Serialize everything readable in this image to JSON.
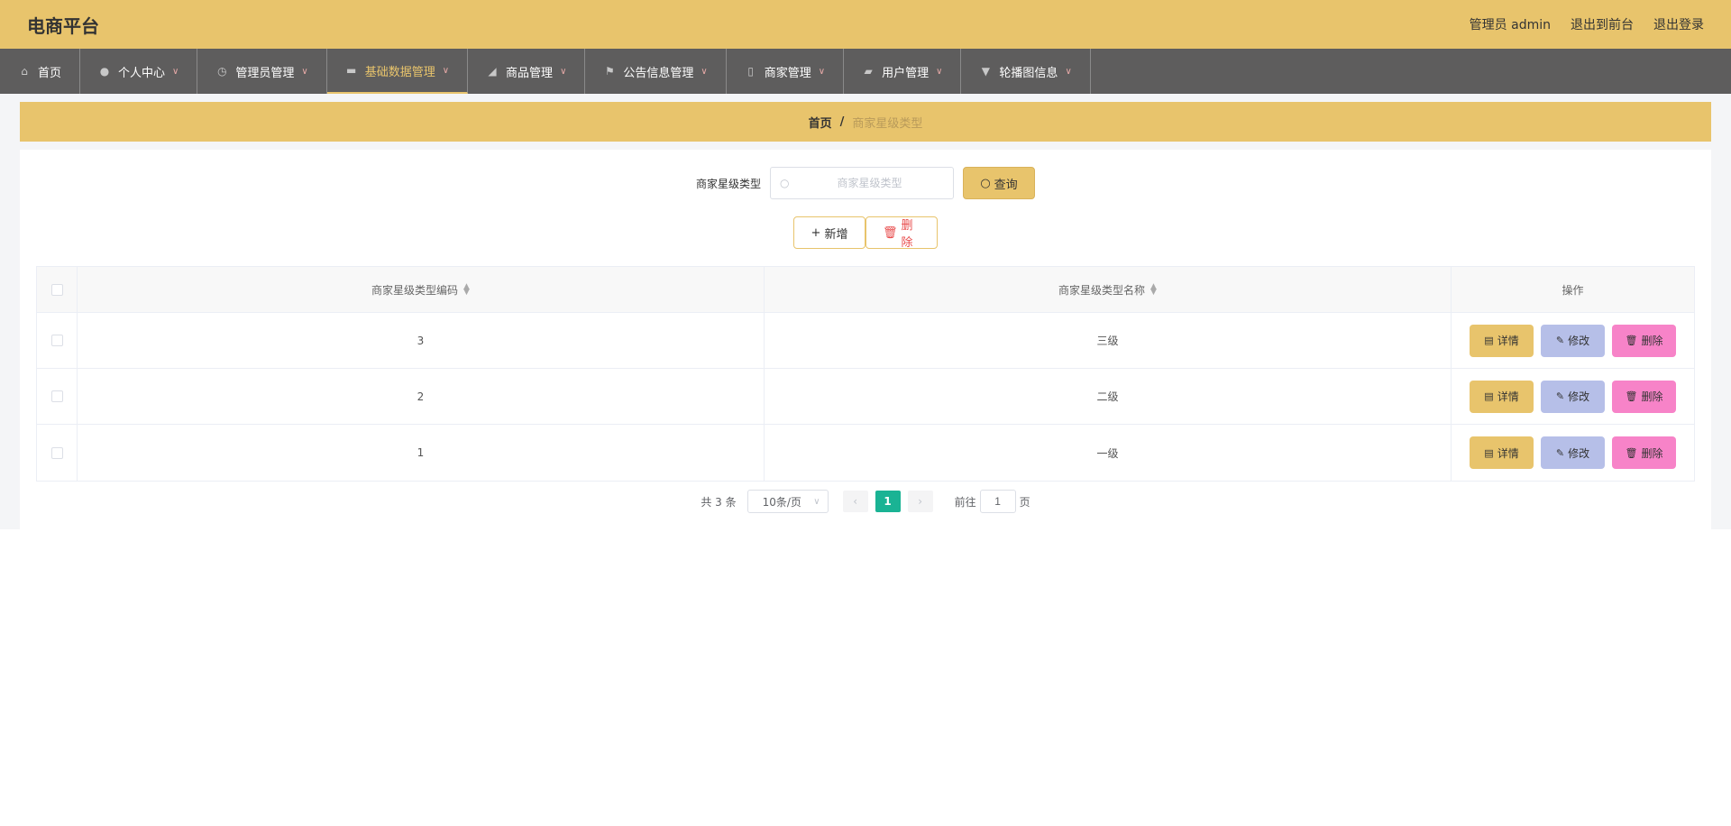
{
  "header": {
    "brand": "电商平台",
    "admin_label": "管理员 admin",
    "to_front": "退出到前台",
    "logout": "退出登录"
  },
  "nav": {
    "items": [
      {
        "label": "首页",
        "icon": "home-icon"
      },
      {
        "label": "个人中心",
        "icon": "user-icon"
      },
      {
        "label": "管理员管理",
        "icon": "clock-icon"
      },
      {
        "label": "基础数据管理",
        "icon": "monitor-icon",
        "active": true
      },
      {
        "label": "商品管理",
        "icon": "goods-icon"
      },
      {
        "label": "公告信息管理",
        "icon": "flag-icon"
      },
      {
        "label": "商家管理",
        "icon": "shop-icon"
      },
      {
        "label": "用户管理",
        "icon": "briefcase-icon"
      },
      {
        "label": "轮播图信息",
        "icon": "pin-icon"
      }
    ]
  },
  "breadcrumb": {
    "home": "首页",
    "separator": "/",
    "current": "商家星级类型"
  },
  "search": {
    "label": "商家星级类型",
    "placeholder": "商家星级类型",
    "button": "查询"
  },
  "actions": {
    "add": "新增",
    "delete": "删除"
  },
  "table": {
    "headers": {
      "code": "商家星级类型编码",
      "name": "商家星级类型名称",
      "ops": "操作"
    },
    "rows": [
      {
        "code": "3",
        "name": "三级"
      },
      {
        "code": "2",
        "name": "二级"
      },
      {
        "code": "1",
        "name": "一级"
      }
    ],
    "op_labels": {
      "detail": "详情",
      "edit": "修改",
      "delete": "删除"
    }
  },
  "pager": {
    "total": "共 3 条",
    "page_size": "10条/页",
    "current_page": "1",
    "goto_label": "前往",
    "goto_value": "1",
    "page_unit": "页"
  },
  "colors": {
    "accent": "#e8c46c",
    "nav_bg": "#5e5d5d",
    "pager_active": "#1ab394",
    "edit_btn": "#b6bfe8",
    "delete_btn": "#f783c8"
  }
}
